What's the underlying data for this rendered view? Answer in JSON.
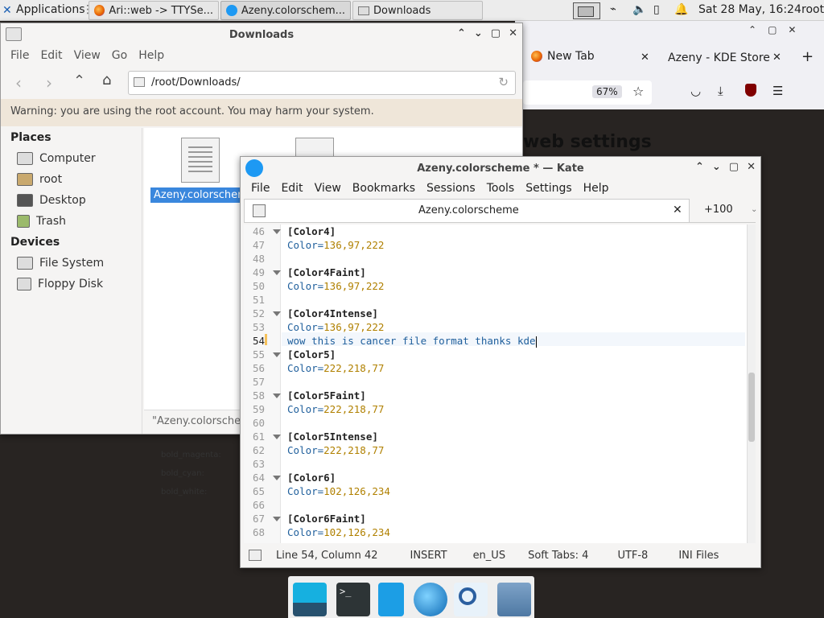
{
  "panel": {
    "apps_label": "Applications",
    "tasks": [
      {
        "label": "Ari::web -> TTYSe..."
      },
      {
        "label": "Azeny.colorschem..."
      },
      {
        "label": "Downloads"
      }
    ],
    "clock": "Sat 28 May, 16:24",
    "user": "root"
  },
  "firefox": {
    "tabs": [
      {
        "label": "New Tab"
      },
      {
        "label": "Azeny - KDE Store"
      }
    ],
    "zoom": "67%",
    "page_heading": "web settings",
    "bg_labels": [
      "bold_magenta:",
      "bold_cyan:",
      "bold_white:"
    ]
  },
  "downloads": {
    "title": "Downloads",
    "menu": [
      "File",
      "Edit",
      "View",
      "Go",
      "Help"
    ],
    "path": "/root/Downloads/",
    "warning": "Warning: you are using the root account. You may harm your system.",
    "places_heading": "Places",
    "places": [
      "Computer",
      "root",
      "Desktop",
      "Trash"
    ],
    "devices_heading": "Devices",
    "devices": [
      "File System",
      "Floppy Disk"
    ],
    "file_label": "Azeny.colorschem",
    "status": "\"Azeny.colorsche"
  },
  "kate": {
    "title": "Azeny.colorscheme * — Kate",
    "menu": [
      "File",
      "Edit",
      "View",
      "Bookmarks",
      "Sessions",
      "Tools",
      "Settings",
      "Help"
    ],
    "tab": "Azeny.colorscheme",
    "tab_extra": "+100",
    "lines": [
      {
        "n": "46",
        "t": "[Color4]",
        "kind": "sec",
        "fold": true
      },
      {
        "n": "47",
        "k": "Color=",
        "v": "136,97,222"
      },
      {
        "n": "48",
        "t": ""
      },
      {
        "n": "49",
        "t": "[Color4Faint]",
        "kind": "sec",
        "fold": true
      },
      {
        "n": "50",
        "k": "Color=",
        "v": "136,97,222"
      },
      {
        "n": "51",
        "t": ""
      },
      {
        "n": "52",
        "t": "[Color4Intense]",
        "kind": "sec",
        "fold": true
      },
      {
        "n": "53",
        "k": "Color=",
        "v": "136,97,222"
      },
      {
        "n": "54",
        "t": "wow this is cancer file format thanks kde",
        "kind": "plain",
        "current": true
      },
      {
        "n": "55",
        "t": "[Color5]",
        "kind": "sec",
        "fold": true
      },
      {
        "n": "56",
        "k": "Color=",
        "v": "222,218,77"
      },
      {
        "n": "57",
        "t": ""
      },
      {
        "n": "58",
        "t": "[Color5Faint]",
        "kind": "sec",
        "fold": true
      },
      {
        "n": "59",
        "k": "Color=",
        "v": "222,218,77"
      },
      {
        "n": "60",
        "t": ""
      },
      {
        "n": "61",
        "t": "[Color5Intense]",
        "kind": "sec",
        "fold": true
      },
      {
        "n": "62",
        "k": "Color=",
        "v": "222,218,77"
      },
      {
        "n": "63",
        "t": ""
      },
      {
        "n": "64",
        "t": "[Color6]",
        "kind": "sec",
        "fold": true
      },
      {
        "n": "65",
        "k": "Color=",
        "v": "102,126,234"
      },
      {
        "n": "66",
        "t": ""
      },
      {
        "n": "67",
        "t": "[Color6Faint]",
        "kind": "sec",
        "fold": true
      },
      {
        "n": "68",
        "k": "Color=",
        "v": "102,126,234"
      }
    ],
    "status": {
      "position": "Line 54, Column 42",
      "mode": "INSERT",
      "lang": "en_US",
      "tabs": "Soft Tabs: 4",
      "encoding": "UTF-8",
      "filetype": "INI Files"
    }
  },
  "colors": {
    "selection": "#3a87dd",
    "warning_bg": "#efe6d9",
    "key": "#1f5f9c",
    "value": "#b08000"
  }
}
